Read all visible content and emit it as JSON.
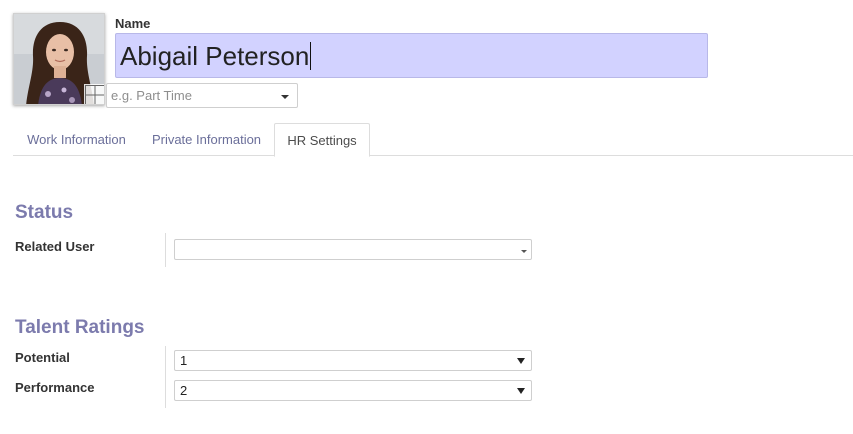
{
  "employee": {
    "name_label": "Name",
    "name_value": "Abigail Peterson",
    "job_placeholder": "e.g. Part Time",
    "avatar_icon": "employee-photo",
    "avatar_edit_icon": "grid-edit-icon"
  },
  "tabs": [
    {
      "label": "Work Information",
      "active": false
    },
    {
      "label": "Private Information",
      "active": false
    },
    {
      "label": "HR Settings",
      "active": true
    }
  ],
  "status_section": {
    "title": "Status",
    "related_user_label": "Related User",
    "related_user_value": ""
  },
  "talent_section": {
    "title": "Talent Ratings",
    "potential_label": "Potential",
    "potential_value": "1",
    "performance_label": "Performance",
    "performance_value": "2"
  },
  "colors": {
    "name_field_bg": "#d2d2ff",
    "section_title": "#7c7bad",
    "tab_text": "#6b6f9a"
  }
}
